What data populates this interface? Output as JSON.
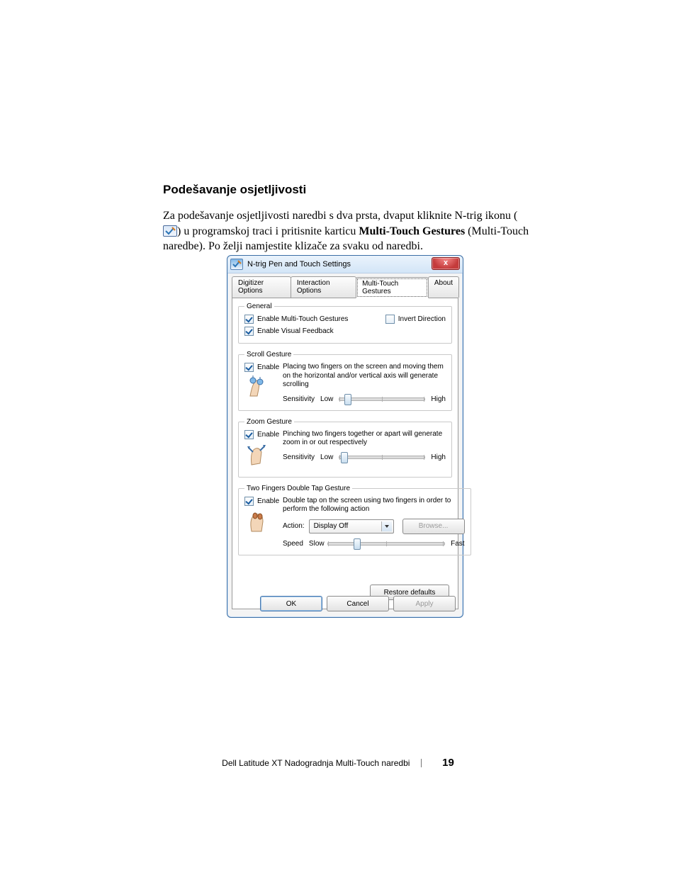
{
  "doc": {
    "heading": "Podešavanje osjetljivosti",
    "para_before_icon": "Za podešavanje osjetljivosti naredbi s dva prsta, dvaput kliknite N-trig ikonu (",
    "para_after_icon": ") u programskoj traci i pritisnite karticu ",
    "bold": "Multi-Touch Gestures",
    "para_after_bold": " (Multi-Touch naredbe). Po želji namjestite klizače za svaku od naredbi."
  },
  "dialog": {
    "title": "N-trig Pen and Touch Settings",
    "close": "x",
    "tabs": [
      "Digitizer Options",
      "Interaction Options",
      "Multi-Touch Gestures",
      "About"
    ],
    "general": {
      "legend": "General",
      "enable_mt": "Enable Multi-Touch Gestures",
      "enable_vf": "Enable Visual Feedback",
      "invert": "Invert Direction"
    },
    "scroll": {
      "legend": "Scroll Gesture",
      "enable": "Enable",
      "desc": "Placing two fingers on the screen and moving them on the horizontal and/or vertical axis will generate scrolling",
      "sens": "Sensitivity",
      "low": "Low",
      "high": "High"
    },
    "zoom": {
      "legend": "Zoom Gesture",
      "enable": "Enable",
      "desc": "Pinching two fingers together or apart will generate zoom in or out respectively",
      "sens": "Sensitivity",
      "low": "Low",
      "high": "High"
    },
    "dtap": {
      "legend": "Two Fingers Double Tap Gesture",
      "enable": "Enable",
      "desc": "Double tap on the screen using two fingers in order to perform the following action",
      "action_label": "Action:",
      "action_value": "Display Off",
      "browse": "Browse...",
      "speed": "Speed",
      "slow": "Slow",
      "fast": "Fast"
    },
    "restore": "Restore defaults",
    "ok": "OK",
    "cancel": "Cancel",
    "apply": "Apply"
  },
  "footer": {
    "text": "Dell Latitude XT Nadogradnja Multi-Touch naredbi",
    "page": "19"
  }
}
